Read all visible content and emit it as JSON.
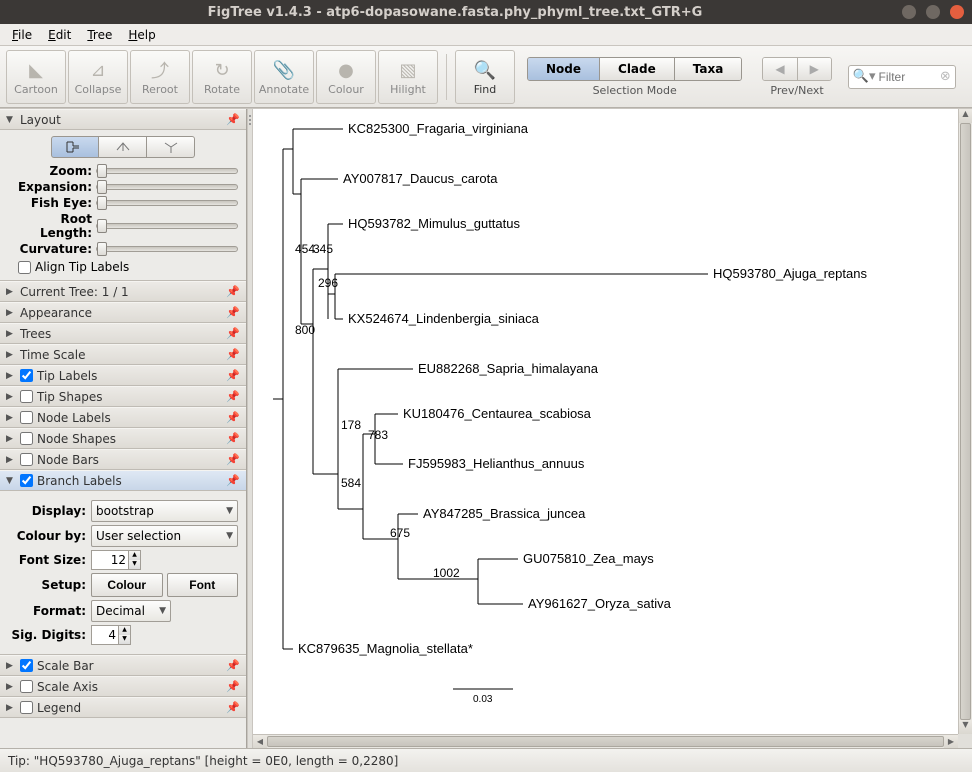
{
  "window": {
    "title": "FigTree v1.4.3 - atp6-dopasowane.fasta.phy_phyml_tree.txt_GTR+G"
  },
  "menubar": {
    "file": "File",
    "edit": "Edit",
    "tree": "Tree",
    "help": "Help"
  },
  "toolbar": {
    "cartoon": "Cartoon",
    "collapse": "Collapse",
    "reroot": "Reroot",
    "rotate": "Rotate",
    "annotate": "Annotate",
    "colour": "Colour",
    "hilight": "Hilight",
    "find": "Find",
    "selection_mode": "Selection Mode",
    "node": "Node",
    "clade": "Clade",
    "taxa": "Taxa",
    "prev_next": "Prev/Next",
    "filter_placeholder": "Filter"
  },
  "sidebar": {
    "layout": {
      "title": "Layout",
      "zoom": "Zoom:",
      "expansion": "Expansion:",
      "fisheye": "Fish Eye:",
      "rootlength": "Root Length:",
      "curvature": "Curvature:",
      "align_tip_labels": "Align Tip Labels"
    },
    "current_tree": "Current Tree: 1 / 1",
    "appearance": "Appearance",
    "trees": "Trees",
    "time_scale": "Time Scale",
    "tip_labels": "Tip Labels",
    "tip_shapes": "Tip Shapes",
    "node_labels": "Node Labels",
    "node_shapes": "Node Shapes",
    "node_bars": "Node Bars",
    "branch_labels": {
      "title": "Branch Labels",
      "display": "Display:",
      "display_val": "bootstrap",
      "colour_by": "Colour by:",
      "colour_by_val": "User selection",
      "font_size": "Font Size:",
      "font_size_val": "12",
      "setup": "Setup:",
      "colour_btn": "Colour",
      "font_btn": "Font",
      "format": "Format:",
      "format_val": "Decimal",
      "sig_digits": "Sig. Digits:",
      "sig_digits_val": "4"
    },
    "scale_bar": "Scale Bar",
    "scale_axis": "Scale Axis",
    "legend": "Legend"
  },
  "tree": {
    "taxa": {
      "t1": "KC825300_Fragaria_virginiana",
      "t2": "AY007817_Daucus_carota",
      "t3": "HQ593782_Mimulus_guttatus",
      "t4": "HQ593780_Ajuga_reptans",
      "t5": "KX524674_Lindenbergia_siniaca",
      "t6": "EU882268_Sapria_himalayana",
      "t7": "KU180476_Centaurea_scabiosa",
      "t8": "FJ595983_Helianthus_annuus",
      "t9": "AY847285_Brassica_juncea",
      "t10": "GU075810_Zea_mays",
      "t11": "AY961627_Oryza_sativa",
      "t12": "KC879635_Magnolia_stellata*"
    },
    "labels": {
      "l1": "454",
      "l2": "345",
      "l3": "296",
      "l4": "800",
      "l5": "178",
      "l6": "783",
      "l7": "584",
      "l8": "675",
      "l9": "1002"
    },
    "scale": "0.03"
  },
  "status": "Tip: \"HQ593780_Ajuga_reptans\" [height = 0E0, length = 0,2280]",
  "chart_data": {
    "type": "phylogenetic_tree",
    "root_outgroup": "KC879635_Magnolia_stellata*",
    "taxa": [
      "KC825300_Fragaria_virginiana",
      "AY007817_Daucus_carota",
      "HQ593782_Mimulus_guttatus",
      "HQ593780_Ajuga_reptans",
      "KX524674_Lindenbergia_siniaca",
      "EU882268_Sapria_himalayana",
      "KU180476_Centaurea_scabiosa",
      "FJ595983_Helianthus_annuus",
      "AY847285_Brassica_juncea",
      "GU075810_Zea_mays",
      "AY961627_Oryza_sativa",
      "KC879635_Magnolia_stellata*"
    ],
    "branch_bootstrap_values": [
      454,
      345,
      296,
      800,
      178,
      783,
      584,
      675,
      1002
    ],
    "scale_bar": 0.03
  }
}
